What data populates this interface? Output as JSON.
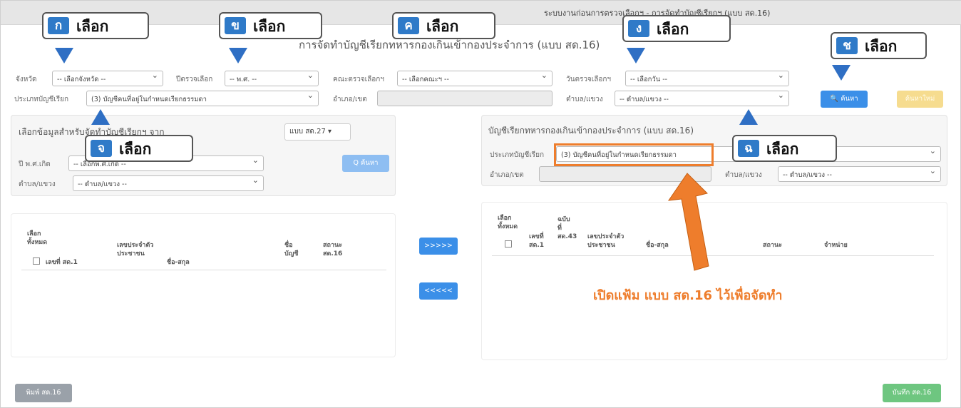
{
  "header": {
    "system_title": "ระบบงานก่อนการตรวจเลือกฯ - การจัดทำบัญชีเรียกฯ (แบบ สด.16)"
  },
  "page": {
    "title": "การจัดทำบัญชีเรียกทหารกองเกินเข้ากองประจำการ (แบบ สด.16)"
  },
  "filters": {
    "province_label": "จังหวัด",
    "province_value": "-- เลือกจังหวัด --",
    "year_label": "ปีตรวจเลือก",
    "year_value": "-- พ.ศ. --",
    "committee_label": "คณะตรวจเลือกฯ",
    "committee_value": "-- เลือกคณะฯ --",
    "date_label": "วันตรวจเลือกฯ",
    "date_value": "-- เลือกวัน --",
    "type_label": "ประเภทบัญชีเรียก",
    "type_value": "(3) บัญชีคนที่อยู่ในกำหนดเรียกธรรมดา",
    "district_label": "อำเภอ/เขต",
    "district_value": "",
    "subdistrict_label": "ตำบล/แขวง",
    "subdistrict_value": "-- ตำบล/แขวง --",
    "search_label": "🔍 ค้นหา",
    "add_label": "ค้นหาใหม่"
  },
  "left_panel": {
    "title": "เลือกข้อมูลสำหรับจัดทำบัญชีเรียกฯ จาก",
    "source_dropdown": "แบบ สด.27 ▾",
    "birth_year_label": "ปี พ.ศ.เกิด",
    "birth_year_value": "-- เลือกพ.ศ.เกิด --",
    "subdistrict_label": "ตำบล/แขวง",
    "subdistrict_value": "-- ตำบล/แขวง --",
    "search_label": "Q ค้นหา"
  },
  "left_table": {
    "select_all": "เลือก\nทั้งหมด",
    "col_no": "เลขที่ สด.1",
    "col_id": "เลขประจำตัว\nประชาชน",
    "col_name": "ชื่อ-สกุล",
    "col_list": "ชื่อ\nบัญชี",
    "col_status": "สถานะ\nสด.16"
  },
  "move": {
    "right": ">>>>>",
    "left": "<<<<<"
  },
  "right_panel": {
    "title": "บัญชีเรียกทหารกองเกินเข้ากองประจำการ (แบบ สด.16)",
    "type_label": "ประเภทบัญชีเรียก",
    "type_value": "(3) บัญชีคนที่อยู่ในกำหนดเรียกธรรมดา",
    "district_label": "อำเภอ/เขต",
    "subdistrict_label": "ตำบล/แขวง",
    "subdistrict_value": "-- ตำบล/แขวง --"
  },
  "right_table": {
    "select_all": "เลือก\nทั้งหมด",
    "col_no": "เลขที่\nสด.1",
    "col_copy": "ฉบับ\nที่\nสด.43",
    "col_id": "เลขประจำตัว\nประชาชน",
    "col_name": "ชื่อ-สกุล",
    "col_status": "สถานะ",
    "col_dispose": "จำหน่าย"
  },
  "footer": {
    "print_label": "พิมพ์ สด.16",
    "save_label": "บันทึก สด.16"
  },
  "annotations": {
    "select_text": "เลือก",
    "badges": [
      "ก",
      "ข",
      "ค",
      "ง",
      "ช",
      "จ",
      "ฉ"
    ],
    "note": "เปิดแฟ้ม แบบ สด.16 ไว้เพื่อจัดทำ",
    "badge_color": "#2f7ac8",
    "highlight_color": "#ee7d2c"
  }
}
